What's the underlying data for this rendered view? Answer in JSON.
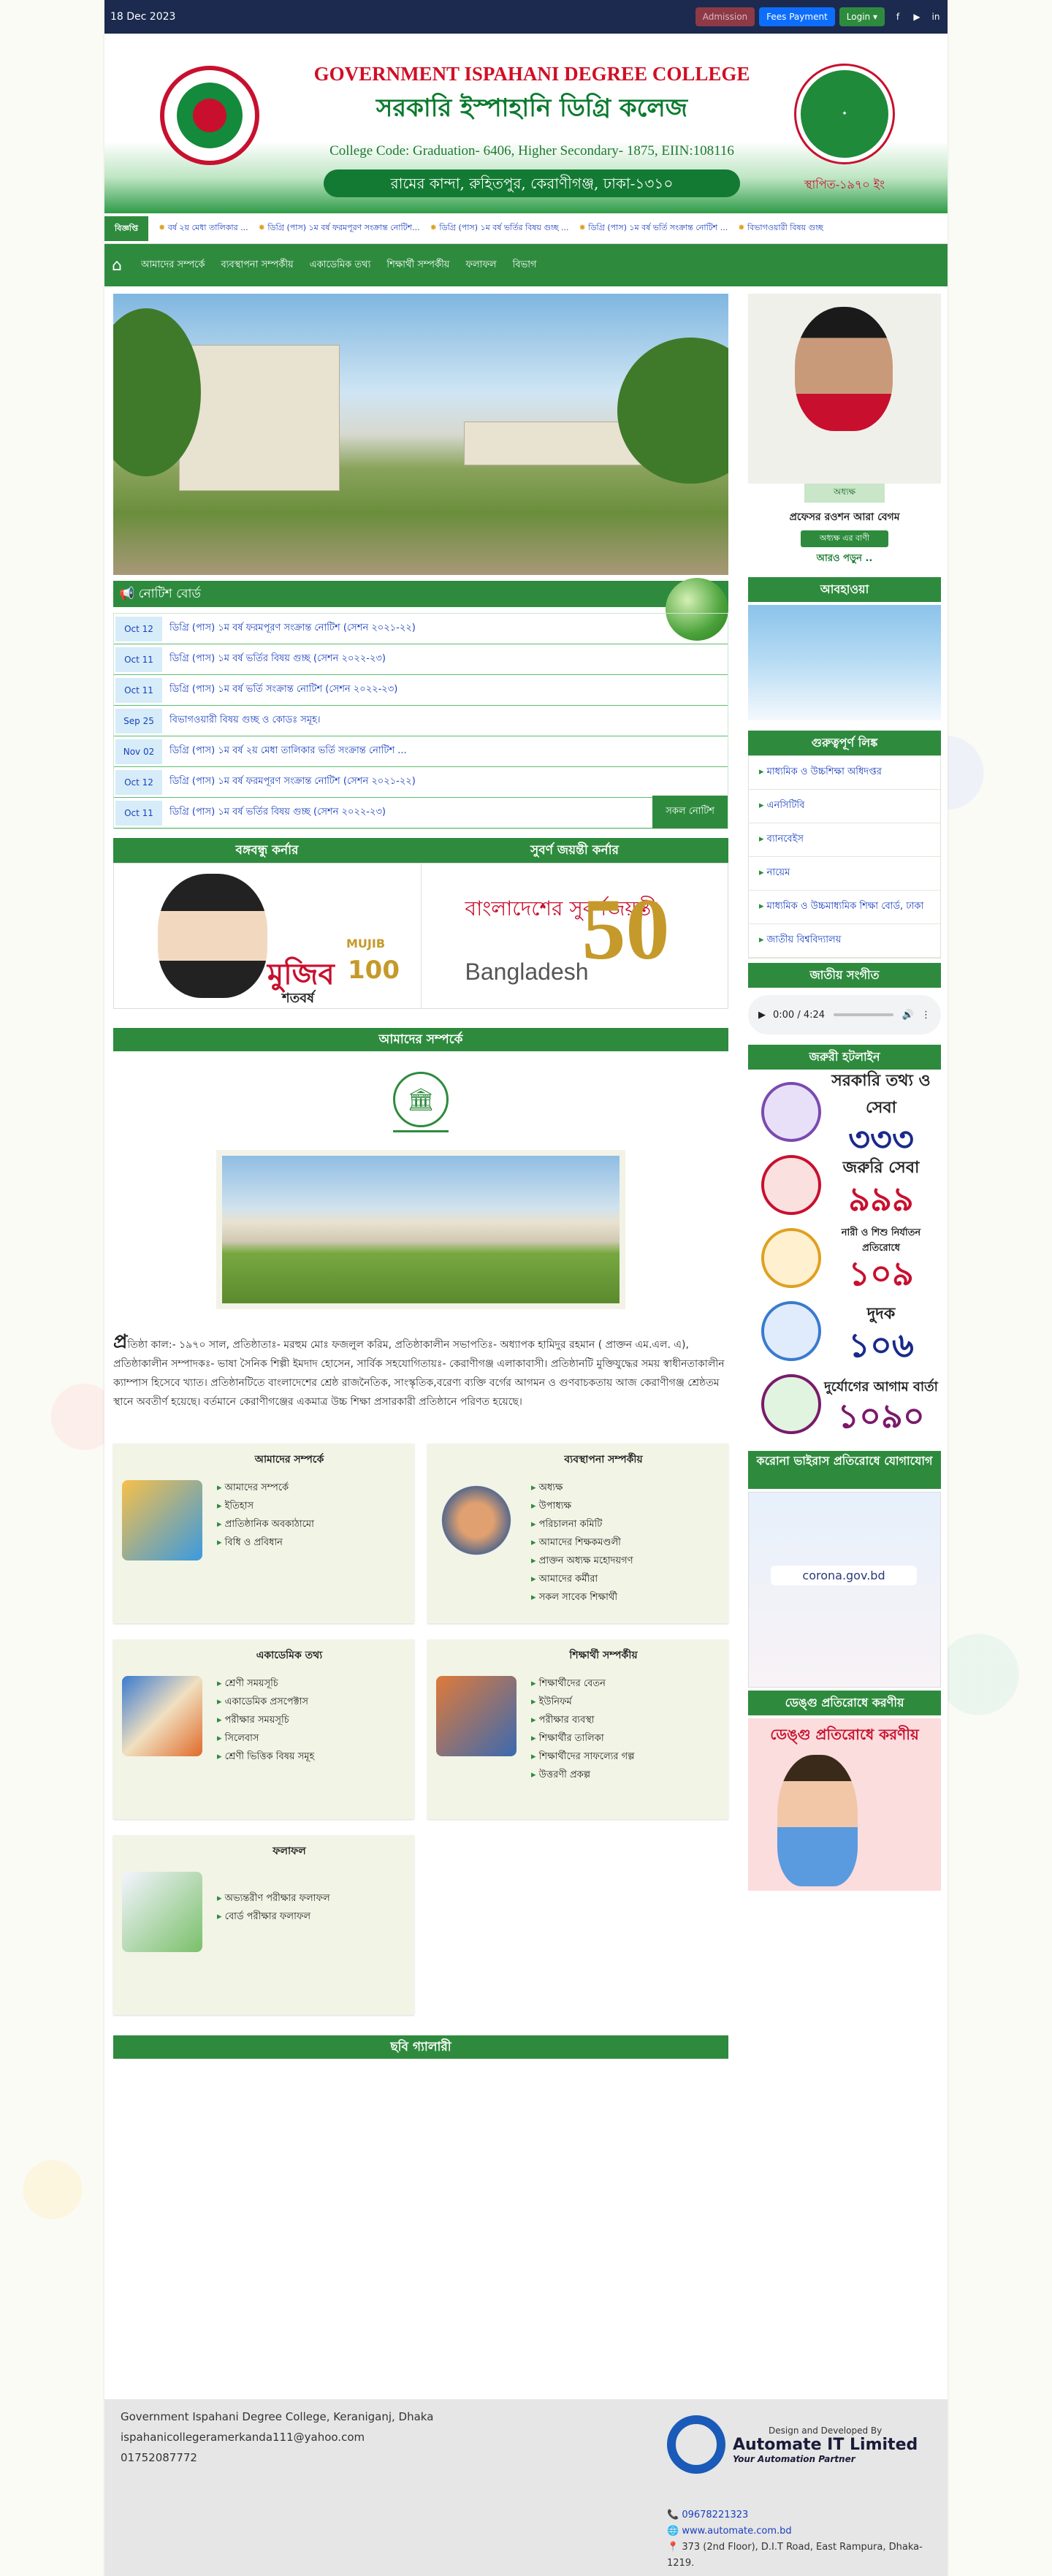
{
  "topbar": {
    "date": "18 Dec 2023",
    "admission": "Admission",
    "fees": "Fees Payment",
    "login": "Login ▾",
    "social": [
      "facebook-icon",
      "youtube-icon",
      "linkedin-icon"
    ]
  },
  "header": {
    "title_en": "GOVERNMENT ISPAHANI DEGREE COLLEGE",
    "title_bn": "সরকারি ইস্পাহানি ডিগ্রি কলেজ",
    "code": "College Code: Graduation- 6406, Higher Secondary- 1875, EIIN:108116",
    "address": "রামের কান্দা, রুহিতপুর, কেরাণীগঞ্জ, ঢাকা-১৩১০",
    "established": "স্থাপিত-১৯৭০ ইং"
  },
  "marquee": {
    "label": "বিজ্ঞপ্তি",
    "items": [
      "বর্ষ ২য় মেধা তালিকার ...",
      "ডিগ্রি (পাস) ১ম বর্ষ ফরমপূরণ সংক্রান্ত নোটিশ...",
      "ডিগ্রি (পাস) ১ম বর্ষ ভর্তির বিষয় গুচ্ছ ...",
      "ডিগ্রি (পাস) ১ম বর্ষ ভর্তি সংক্রান্ত নোটিশ ...",
      "বিভাগওয়ারী বিষয় গুচ্ছ"
    ]
  },
  "nav": {
    "items": [
      "আমাদের সম্পর্কে",
      "ব্যবস্থাপনা সম্পর্কীয়",
      "একাডেমিক তথ্য",
      "শিক্ষার্থী সম্পর্কীয়",
      "ফলাফল",
      "বিভাগ"
    ]
  },
  "notice": {
    "title": "নোটিশ বোর্ড",
    "rows": [
      {
        "date": "Oct 12",
        "text": "ডিগ্রি (পাস) ১ম বর্ষ ফরমপূরণ সংক্রান্ত নোটিশ (সেশন ২০২১-২২)"
      },
      {
        "date": "Oct 11",
        "text": "ডিগ্রি (পাস) ১ম বর্ষ ভর্তির বিষয় গুচ্ছ (সেশন ২০২২-২৩)"
      },
      {
        "date": "Oct 11",
        "text": "ডিগ্রি (পাস) ১ম বর্ষ ভর্তি সংক্রান্ত নোটিশ (সেশন ২০২২-২৩)"
      },
      {
        "date": "Sep 25",
        "text": "বিভাগওয়ারী বিষয় গুচ্ছ ও কোডঃ সমূহ।"
      },
      {
        "date": "Nov 02",
        "text": "ডিগ্রি (পাস) ১ম বর্ষ ২য় মেধা তালিকার ভর্তি সংক্রান্ত নোটিশ ..."
      },
      {
        "date": "Oct 12",
        "text": "ডিগ্রি (পাস) ১ম বর্ষ ফরমপূরণ সংক্রান্ত নোটিশ (সেশন ২০২১-২২)"
      },
      {
        "date": "Oct 11",
        "text": "ডিগ্রি (পাস) ১ম বর্ষ ভর্তির বিষয় গুচ্ছ (সেশন ২০২২-২৩)"
      }
    ],
    "all_button": "সকল নোটিশ"
  },
  "corners": {
    "bangabandhu": "বঙ্গবন্ধু কর্নার",
    "jubilee": "সুবর্ণ জয়ন্তী কর্নার",
    "mujib_text": "মুজিব",
    "mujib_sub": "শতবর্ষ",
    "mujib_en": "MUJIB",
    "mujib_100": "100",
    "bd50_bn": "বাংলাদেশের সুবর্ণজয়ন্তী",
    "bd50_en": "Bangladesh",
    "bd50_num": "50"
  },
  "about": {
    "title": "আমাদের সম্পর্কে",
    "dropcap": "প্র",
    "text": "তিষ্ঠা কাল:- ১৯৭০ সাল, প্রতিষ্ঠাতাঃ- মরহুম মোঃ ফজলুল করিম, প্রতিষ্ঠাকালীন সভাপতিঃ- অধ্যাপক হামিদুর রহমান ( প্রাক্তন এম.এল. এ), প্রতিষ্ঠাকালীন সম্পাদকঃ- ভাষা সৈনিক শিল্পী ইমদাদ হোসেন, সার্বিক সহযোগিতায়ঃ- কেরাণীগঞ্জ এলাকাবাসী। প্রতিষ্ঠানটি মুক্তিযুদ্ধের সময় স্বাধীনতাকালীন ক্যাম্পাস হিসেবে খ্যাত। প্রতিষ্ঠানটিতে বাংলাদেশের শ্রেষ্ঠ রাজনৈতিক, সাংস্কৃতিক,বরেণ্য ব্যক্তি বর্গের আগমন ও গুণবাচকতায় আজ কেরাণীগঞ্জ শ্রেষ্ঠতম স্থানে অবতীর্ণ হয়েছে। বর্তমানে কেরাণীগঞ্জের একমাত্র উচ্চ শিক্ষা প্রসারকারী প্রতিষ্ঠানে পরিণত হয়েছে।"
  },
  "cards": [
    {
      "title": "আমাদের সম্পর্কে",
      "items": [
        "আমাদের সম্পর্কে",
        "ইতিহাস",
        "প্রাতিষ্ঠানিক অবকাঠামো",
        "বিধি ও প্রবিধান"
      ]
    },
    {
      "title": "ব্যবস্থাপনা সম্পর্কীয়",
      "items": [
        "অধ্যক্ষ",
        "উপাধ্যক্ষ",
        "পরিচালনা কমিটি",
        "আমাদের শিক্ষকমণ্ডলী",
        "প্রাক্তন অধ্যক্ষ মহোদয়গণ",
        "আমাদের কর্মীরা",
        "সকল সাবেক শিক্ষার্থী"
      ]
    },
    {
      "title": "একাডেমিক তথ্য",
      "items": [
        "শ্রেণী সময়সূচি",
        "একাডেমিক প্রসপেক্টাস",
        "পরীক্ষার সময়সূচি",
        "সিলেবাস",
        "শ্রেণী ভিত্তিক বিষয় সমূহ"
      ]
    },
    {
      "title": "শিক্ষার্থী সম্পর্কীয়",
      "items": [
        "শিক্ষার্থীদের বেতন",
        "ইউনিফর্ম",
        "পরীক্ষার ব্যবস্থা",
        "শিক্ষার্থীর তালিকা",
        "শিক্ষার্থীদের সাফল্যের গল্প",
        "উত্তরণী প্রকল্প"
      ]
    },
    {
      "title": "ফলাফল",
      "items": [
        "অভ্যন্তরীণ পরীক্ষার ফলাফল",
        "বোর্ড পরীক্ষার ফলাফল"
      ]
    }
  ],
  "gallery": {
    "title": "ছবি গ্যালারী"
  },
  "sidebar": {
    "principal_role": "অধ্যক্ষ",
    "principal_name": "প্রফেসর রওশন আরা বেগম",
    "principal_btn": "অধ্যক্ষ এর বাণী",
    "principal_more": "আরও পড়ুন ..",
    "weather_title": "আবহাওয়া",
    "links_title": "গুরুত্বপূর্ণ লিঙ্ক",
    "links": [
      "মাধ্যমিক ও উচ্চশিক্ষা অধিদপ্তর",
      "এনসিটিবি",
      "ব্যানবেইস",
      "নায়েম",
      "মাধ্যমিক ও উচ্চমাধ্যমিক শিক্ষা বোর্ড, ঢাকা",
      "জাতীয় বিশ্ববিদ্যালয়"
    ],
    "anthem_title": "জাতীয় সংগীত",
    "audio_time": "0:00 / 4:24",
    "hotline_title": "জরুরী হটলাইন",
    "hotlines": [
      {
        "label": "সরকারি তথ্য ও সেবা",
        "num": "৩৩৩",
        "color": "#1a2a8a"
      },
      {
        "label": "জরুরি সেবা",
        "num": "৯৯৯",
        "color": "#c8102e"
      },
      {
        "label": "নারী ও শিশু নির্যাতন প্রতিরোধে",
        "num": "১০৯",
        "color": "#c8102e"
      },
      {
        "label": "দুদক",
        "num": "১০৬",
        "color": "#1a2a8a"
      },
      {
        "label": "দুর্যোগের আগাম বার্তা",
        "num": "১০৯০",
        "color": "#7a1a6a"
      }
    ],
    "corona_title": "করোনা ভাইরাস প্রতিরোধে যোগাযোগ",
    "corona_site": "corona.gov.bd",
    "dengue_title": "ডেঙ্গু প্রতিরোধে করণীয়",
    "dengue_img_text": "ডেঙ্গু প্রতিরোধে করণীয়"
  },
  "footer": {
    "name": "Government Ispahani Degree College, Keraniganj, Dhaka",
    "email": "ispahanicollegeramerkanda111@yahoo.com",
    "phone": "01752087772",
    "designed_by": "Design and Developed By",
    "company": "Automate IT Limited",
    "tagline": "Your Automation Partner",
    "company_phone": "09678221323",
    "company_web": "www.automate.com.bd",
    "company_addr": "373 (2nd Floor), D.I.T Road, East Rampura, Dhaka-1219."
  }
}
